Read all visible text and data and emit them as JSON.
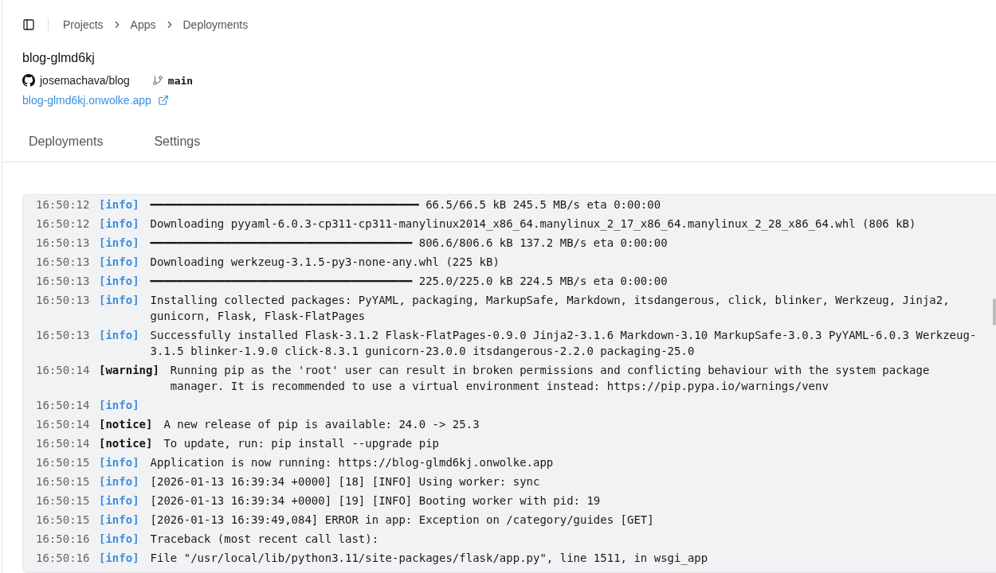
{
  "breadcrumbs": [
    "Projects",
    "Apps",
    "Deployments"
  ],
  "app": {
    "name": "blog-glmd6kj",
    "repo": "josemachava/blog",
    "branch": "main",
    "url": "blog-glmd6kj.onwolke.app"
  },
  "tabs": [
    {
      "label": "Deployments",
      "selected": false
    },
    {
      "label": "Settings",
      "selected": false
    }
  ],
  "log": [
    {
      "time": "16:50:12",
      "level": "[info]",
      "kind": "info",
      "message": "━━━━━━━━━━━━━━━━━━━━━━━━━━━━━━━━━━━━━━━━ 66.5/66.5 kB 245.5 MB/s eta 0:00:00"
    },
    {
      "time": "16:50:12",
      "level": "[info]",
      "kind": "info",
      "message": "Downloading pyyaml-6.0.3-cp311-cp311-manylinux2014_x86_64.manylinux_2_17_x86_64.manylinux_2_28_x86_64.whl (806 kB)"
    },
    {
      "time": "16:50:13",
      "level": "[info]",
      "kind": "info",
      "message": "━━━━━━━━━━━━━━━━━━━━━━━━━━━━━━━━━━━━━━━ 806.6/806.6 kB 137.2 MB/s eta 0:00:00"
    },
    {
      "time": "16:50:13",
      "level": "[info]",
      "kind": "info",
      "message": "Downloading werkzeug-3.1.5-py3-none-any.whl (225 kB)"
    },
    {
      "time": "16:50:13",
      "level": "[info]",
      "kind": "info",
      "message": "━━━━━━━━━━━━━━━━━━━━━━━━━━━━━━━━━━━━━━━ 225.0/225.0 kB 224.5 MB/s eta 0:00:00"
    },
    {
      "time": "16:50:13",
      "level": "[info]",
      "kind": "info",
      "message": "Installing collected packages: PyYAML, packaging, MarkupSafe, Markdown, itsdangerous, click, blinker, Werkzeug, Jinja2, gunicorn, Flask, Flask-FlatPages"
    },
    {
      "time": "16:50:13",
      "level": "[info]",
      "kind": "info",
      "message": "Successfully installed Flask-3.1.2 Flask-FlatPages-0.9.0 Jinja2-3.1.6 Markdown-3.10 MarkupSafe-3.0.3 PyYAML-6.0.3 Werkzeug-3.1.5 blinker-1.9.0 click-8.3.1 gunicorn-23.0.0 itsdangerous-2.2.0 packaging-25.0"
    },
    {
      "time": "16:50:14",
      "level": "[warning]",
      "kind": "warning",
      "message": "Running pip as the 'root' user can result in broken permissions and conflicting behaviour with the system package manager. It is recommended to use a virtual environment instead: https://pip.pypa.io/warnings/venv"
    },
    {
      "time": "16:50:14",
      "level": "[info]",
      "kind": "info"
    },
    {
      "time": "16:50:14",
      "level": "[notice]",
      "kind": "notice",
      "message": "A new release of pip is available: 24.0 -> 25.3"
    },
    {
      "time": "16:50:14",
      "level": "[notice]",
      "kind": "notice",
      "message": "To update, run: pip install --upgrade pip"
    },
    {
      "time": "16:50:15",
      "level": "[info]",
      "kind": "info",
      "message": "Application is now running: https://blog-glmd6kj.onwolke.app"
    },
    {
      "time": "16:50:15",
      "level": "[info]",
      "kind": "info",
      "message": "[2026-01-13 16:39:34 +0000] [18] [INFO] Using worker: sync"
    },
    {
      "time": "16:50:15",
      "level": "[info]",
      "kind": "info",
      "message": "[2026-01-13 16:39:34 +0000] [19] [INFO] Booting worker with pid: 19"
    },
    {
      "time": "16:50:15",
      "level": "[info]",
      "kind": "info",
      "message": "[2026-01-13 16:39:49,084] ERROR in app: Exception on /category/guides [GET]"
    },
    {
      "time": "16:50:16",
      "level": "[info]",
      "kind": "info",
      "message": "Traceback (most recent call last):"
    },
    {
      "time": "16:50:16",
      "level": "[info]",
      "kind": "info",
      "message": "File \"/usr/local/lib/python3.11/site-packages/flask/app.py\", line 1511, in wsgi_app"
    }
  ]
}
